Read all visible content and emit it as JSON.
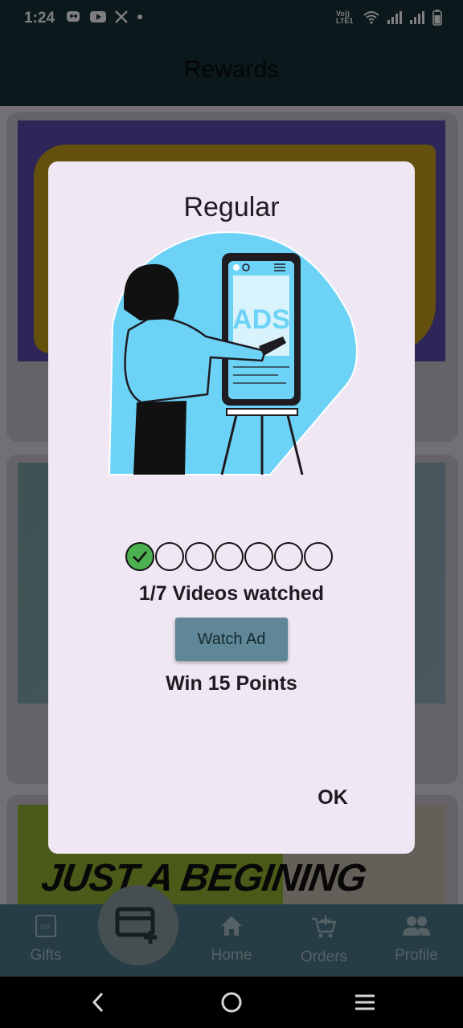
{
  "status_bar": {
    "time": "1:24",
    "network_label": "Vo)) LTE1"
  },
  "app_bar": {
    "title": "Rewards"
  },
  "background": {
    "banner3_text": "JUST A BEGINING"
  },
  "dialog": {
    "title": "Regular",
    "illustration_text": "ADS",
    "progress": {
      "watched": 1,
      "total": 7
    },
    "progress_text": "1/7 Videos watched",
    "watch_button": "Watch Ad",
    "reward_text": "Win 15 Points",
    "ok_button": "OK"
  },
  "bottom_nav": {
    "items": [
      {
        "label": "Gifts",
        "icon": "gif-icon"
      },
      {
        "label": "Home",
        "icon": "home-icon"
      },
      {
        "label": "Orders",
        "icon": "cart-add-icon"
      },
      {
        "label": "Profile",
        "icon": "people-icon"
      }
    ],
    "fab_icon": "card-add-icon"
  },
  "colors": {
    "app_bar": "#173038",
    "dialog_bg": "#efe7f4",
    "button": "#5f8797",
    "done_dot": "#4caf50",
    "nav_bg": "#4e7b8a"
  }
}
